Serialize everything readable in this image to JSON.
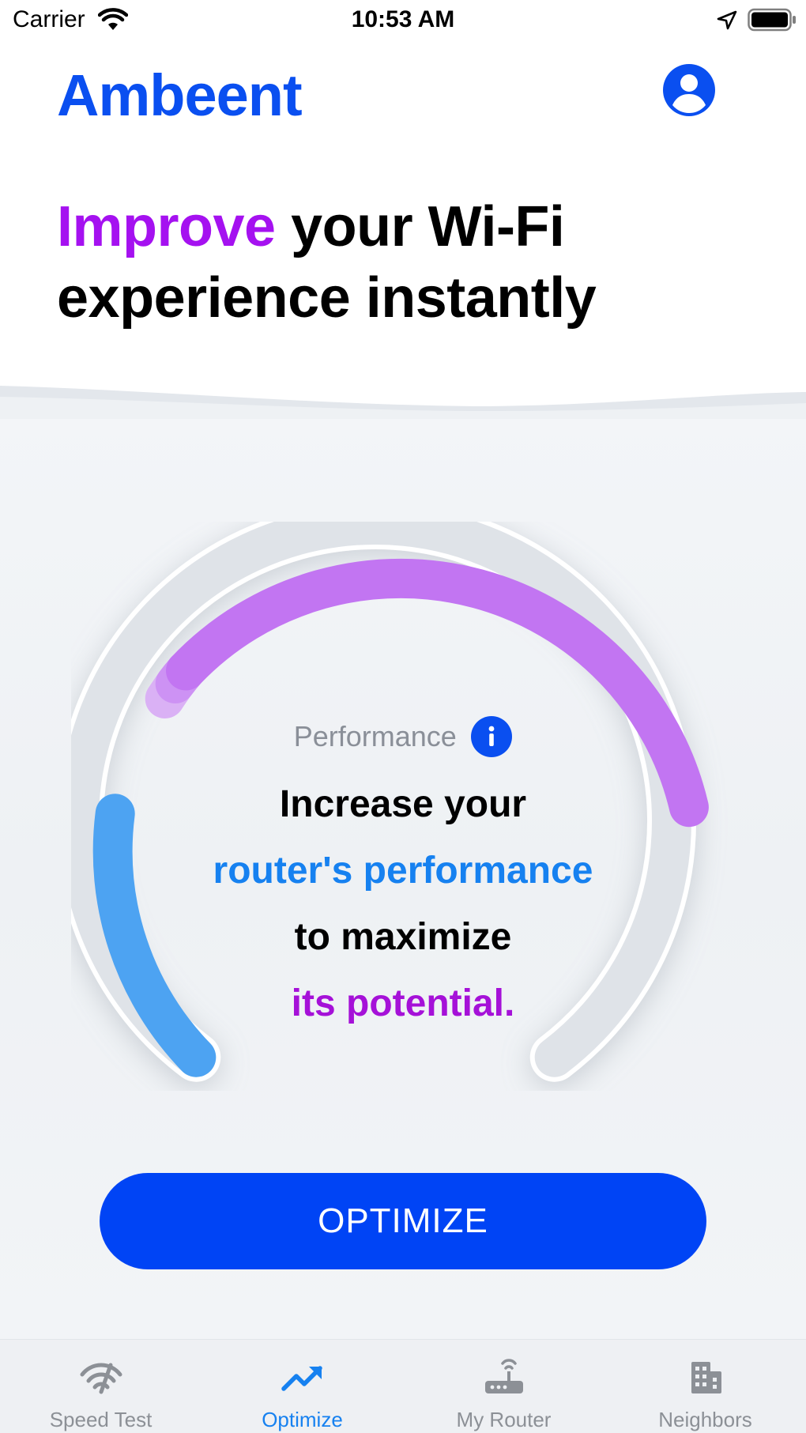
{
  "status_bar": {
    "carrier": "Carrier",
    "time": "10:53 AM",
    "icons": [
      "wifi-icon",
      "location-arrow-icon",
      "battery-icon"
    ]
  },
  "header": {
    "app_name": "Ambeent",
    "profile_icon": "user-circle-icon"
  },
  "hero": {
    "accent_word": "Improve",
    "rest_line1": " your Wi-Fi",
    "line2": "experience instantly"
  },
  "gauge": {
    "label": "Performance",
    "info_icon": "info-icon",
    "line1": "Increase your",
    "line2": "router's performance",
    "line3": "to maximize",
    "line4": "its potential.",
    "colors": {
      "blue_segment": "#4da3f2",
      "purple_segment": "#c275f2",
      "track": "#dfe3e8"
    }
  },
  "optimize_button": {
    "label": "OPTIMIZE"
  },
  "tabs": [
    {
      "label": "Speed Test",
      "icon": "speed-test-icon",
      "active": false
    },
    {
      "label": "Optimize",
      "icon": "trend-up-icon",
      "active": true
    },
    {
      "label": "My Router",
      "icon": "router-icon",
      "active": false
    },
    {
      "label": "Neighbors",
      "icon": "building-icon",
      "active": false
    }
  ],
  "colors": {
    "brand_blue": "#0a4ff0",
    "button_blue": "#0044f5",
    "accent_purple": "#a511f0",
    "link_blue": "#1681f0"
  }
}
